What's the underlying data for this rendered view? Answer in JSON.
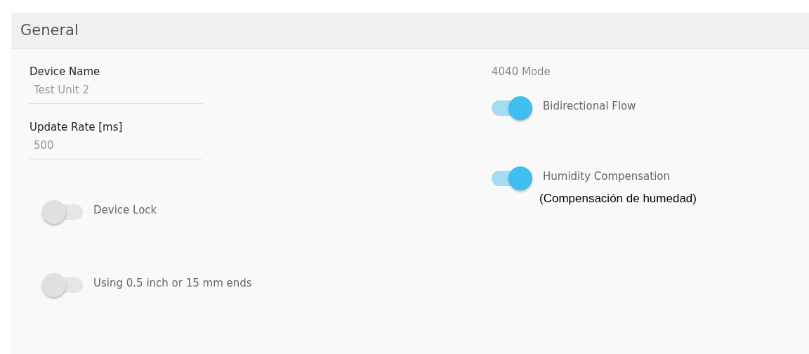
{
  "section": {
    "title": "General"
  },
  "fields": [
    {
      "label": "Device Name",
      "value": "Test Unit 2"
    },
    {
      "label": "Update Rate [ms]",
      "value": "500"
    }
  ],
  "left_switches": [
    {
      "label": "Device Lock",
      "on": false
    },
    {
      "label": "Using 0.5 inch or 15 mm ends",
      "on": false
    }
  ],
  "mode_group": {
    "title": "4040 Mode",
    "switches": [
      {
        "label": "Bidirectional Flow",
        "on": true
      },
      {
        "label": "Humidity Compensation",
        "on": true,
        "note": "(Compensación de humedad)"
      }
    ]
  }
}
